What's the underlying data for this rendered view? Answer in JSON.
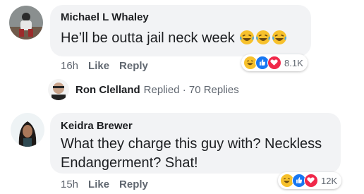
{
  "comments": [
    {
      "author": "Michael L Whaley",
      "text": "He’ll be outta jail neck week",
      "emoji_icons": [
        "laughing-emoji-icon",
        "laughing-emoji-icon",
        "laughing-emoji-icon"
      ],
      "time": "16h",
      "like_label": "Like",
      "reply_label": "Reply",
      "reaction_icons": [
        "haha-reaction-icon",
        "like-reaction-icon",
        "love-reaction-icon"
      ],
      "reaction_count": "8.1K"
    },
    {
      "author": "Keidra Brewer",
      "text_line1": "What they charge this guy with? Neckless",
      "text_line2": "Endangerment? Shat!",
      "time": "15h",
      "like_label": "Like",
      "reply_label": "Reply",
      "reaction_icons": [
        "haha-reaction-icon",
        "like-reaction-icon",
        "love-reaction-icon"
      ],
      "reaction_count": "12K"
    }
  ],
  "reply_summary": {
    "name": "Ron Clelland",
    "text": "Replied · 70 Replies"
  },
  "colors": {
    "bubble": "#f2f3f5",
    "meta_text": "#606770",
    "like_blue": "#1877f2",
    "love_red": "#f0284a",
    "haha_yellow": "#f7c12c"
  }
}
